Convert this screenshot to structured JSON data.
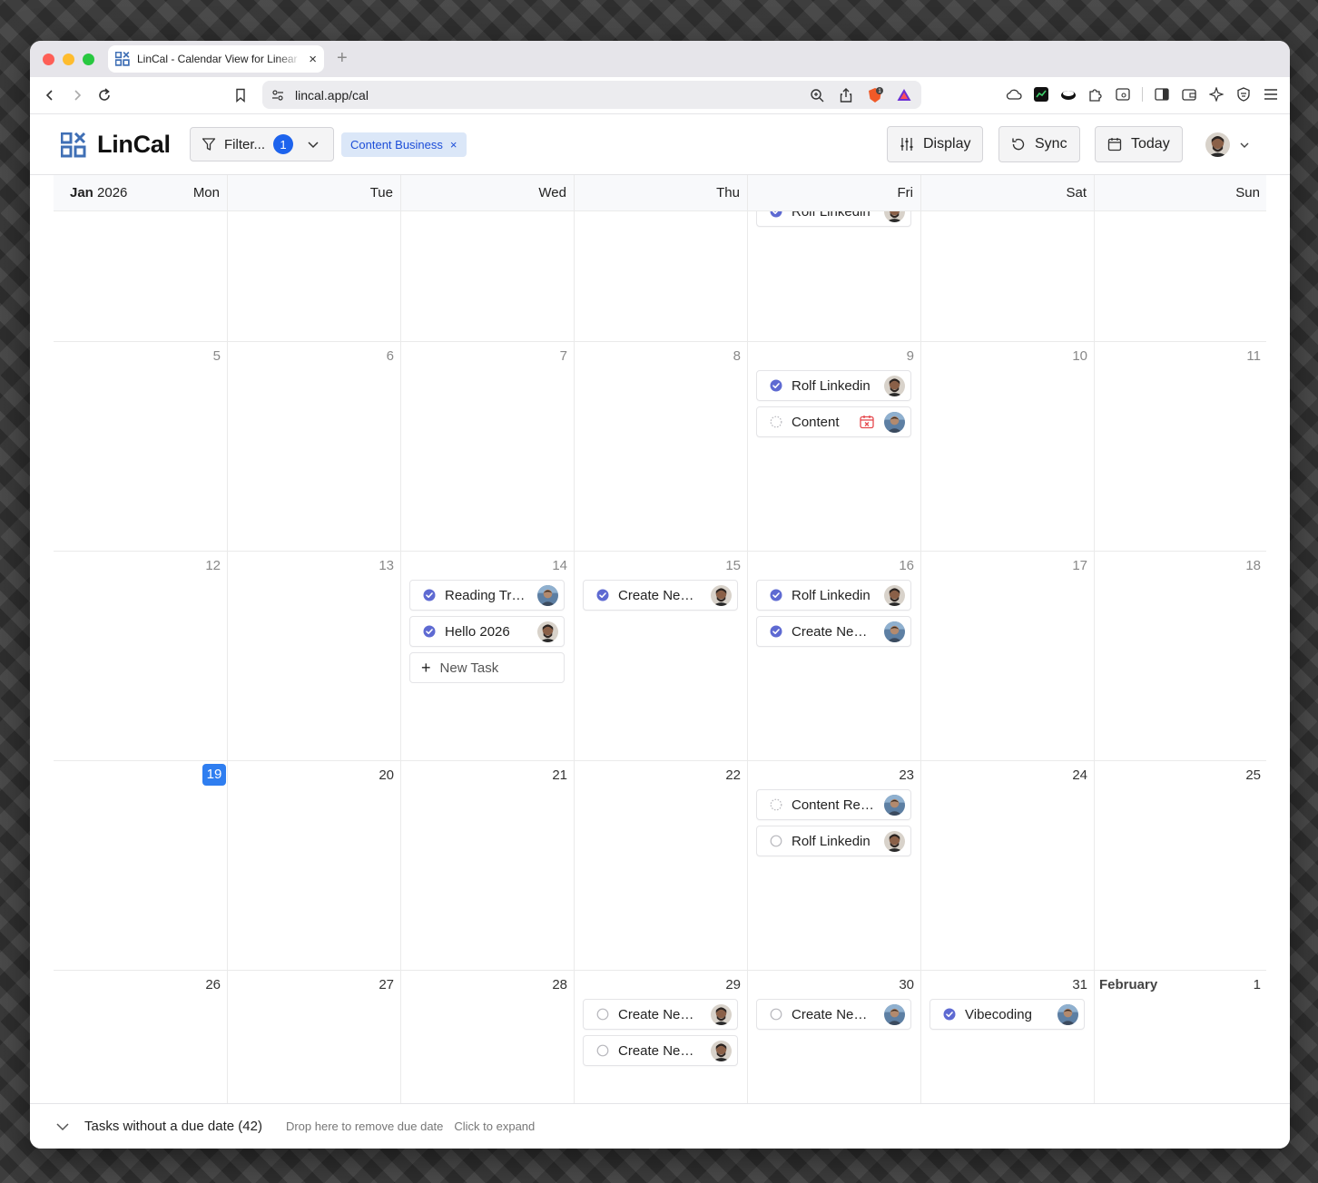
{
  "browser": {
    "tab_title": "LinCal - Calendar View for Linear",
    "url": "lincal.app/cal",
    "new_tab_glyph": "+",
    "close_glyph": "×"
  },
  "app": {
    "logo_text": "LinCal",
    "filter_label": "Filter...",
    "filter_count": "1",
    "active_filter_chip": "Content Business",
    "chip_remove": "×",
    "buttons": {
      "display": "Display",
      "sync": "Sync",
      "today": "Today"
    }
  },
  "calendar": {
    "month_label_bold": "Jan",
    "month_label_year": "2026",
    "weekdays": [
      "Mon",
      "Tue",
      "Wed",
      "Thu",
      "Fri",
      "Sat",
      "Sun"
    ],
    "partial_week": {
      "fri_task": {
        "title": "Rolf Linkedin",
        "status": "done",
        "avatar": "a"
      }
    },
    "weeks": [
      {
        "days": [
          "5",
          "6",
          "7",
          "8",
          "9",
          "10",
          "11"
        ],
        "fri_tasks": [
          {
            "title": "Rolf Linkedin",
            "status": "done",
            "avatar": "a"
          },
          {
            "title": "Content",
            "status": "in-progress",
            "avatar": "b",
            "overdue": true
          }
        ]
      },
      {
        "days": [
          "12",
          "13",
          "14",
          "15",
          "16",
          "17",
          "18"
        ],
        "wed_tasks": [
          {
            "title": "Reading Tracker",
            "status": "done",
            "avatar": "b"
          },
          {
            "title": "Hello 2026",
            "status": "done",
            "avatar": "a"
          }
        ],
        "wed_new_task": "New Task",
        "thu_tasks": [
          {
            "title": "Create Newsletter",
            "status": "done",
            "avatar": "a"
          }
        ],
        "fri_tasks": [
          {
            "title": "Rolf Linkedin",
            "status": "done",
            "avatar": "a"
          },
          {
            "title": "Create Newsletter",
            "status": "done",
            "avatar": "b"
          }
        ]
      },
      {
        "days": [
          "19",
          "20",
          "21",
          "22",
          "23",
          "24",
          "25"
        ],
        "today_index": 0,
        "fri_tasks": [
          {
            "title": "Content Review",
            "status": "in-progress",
            "avatar": "b"
          },
          {
            "title": "Rolf Linkedin",
            "status": "todo",
            "avatar": "a"
          }
        ]
      },
      {
        "days": [
          "26",
          "27",
          "28",
          "29",
          "30",
          "31",
          "1"
        ],
        "sun_month": "February",
        "thu_tasks": [
          {
            "title": "Create Newsletter",
            "status": "todo",
            "avatar": "a"
          },
          {
            "title": "Create Newsletter",
            "status": "todo",
            "avatar": "a"
          }
        ],
        "fri_tasks": [
          {
            "title": "Create Newsletter",
            "status": "todo",
            "avatar": "b"
          }
        ],
        "sat_tasks": [
          {
            "title": "Vibecoding",
            "status": "done",
            "avatar": "b"
          }
        ]
      }
    ]
  },
  "bottom_bar": {
    "label": "Tasks without a due date (42)",
    "hint_drop": "Drop here to remove due date",
    "hint_expand": "Click to expand"
  },
  "colors": {
    "accent": "#1d63ed",
    "done_status": "#5e6ad2",
    "today_badge": "#2f7ef0",
    "chip_bg": "#dbe7f8",
    "overdue": "#e5484d"
  }
}
